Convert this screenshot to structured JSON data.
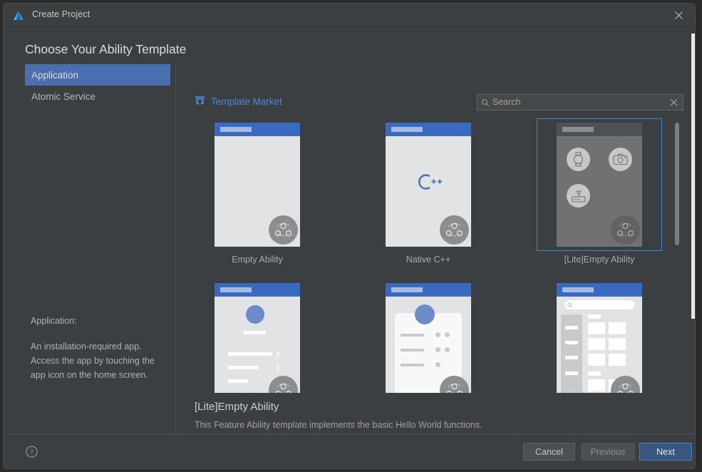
{
  "window": {
    "title": "Create Project",
    "logo_icon": "deveco-triangle-logo",
    "close_icon": "close-icon"
  },
  "heading": "Choose Your Ability Template",
  "categories": {
    "items": [
      {
        "label": "Application",
        "selected": true
      },
      {
        "label": "Atomic Service",
        "selected": false
      }
    ],
    "description_title": "Application:",
    "description_body": "An installation-required app. Access the app by touching the app icon on the home screen."
  },
  "market": {
    "label": "Template Market",
    "icon": "storefront-icon",
    "color": "#4a88d8"
  },
  "search": {
    "placeholder": "Search",
    "value": "",
    "search_icon": "search-icon",
    "clear_icon": "clear-x-icon"
  },
  "templates": [
    {
      "label": "Empty Ability",
      "selected": false,
      "preview": "empty",
      "badge_icon": "harmonyos-badge-icon"
    },
    {
      "label": "Native C++",
      "selected": false,
      "preview": "cpp",
      "badge_icon": "harmonyos-badge-icon"
    },
    {
      "label": "[Lite]Empty Ability",
      "selected": true,
      "preview": "lite-devices",
      "badge_icon": "harmonyos-badge-icon"
    },
    {
      "label": "",
      "selected": false,
      "preview": "list-settings",
      "badge_icon": "harmonyos-badge-icon"
    },
    {
      "label": "",
      "selected": false,
      "preview": "profile-card",
      "badge_icon": "harmonyos-badge-icon"
    },
    {
      "label": "",
      "selected": false,
      "preview": "category-grid",
      "badge_icon": "harmonyos-badge-icon"
    }
  ],
  "detail": {
    "title": "[Lite]Empty Ability",
    "description": "This Feature Ability template implements the basic Hello World functions."
  },
  "footer": {
    "help_icon": "help-circle-icon",
    "cancel_label": "Cancel",
    "previous_label": "Previous",
    "next_label": "Next"
  },
  "colors": {
    "accent_blue": "#3b87d8",
    "selection_blue": "#4b6eaf",
    "primary_button": "#365880",
    "window_bg": "#3c3f41"
  }
}
